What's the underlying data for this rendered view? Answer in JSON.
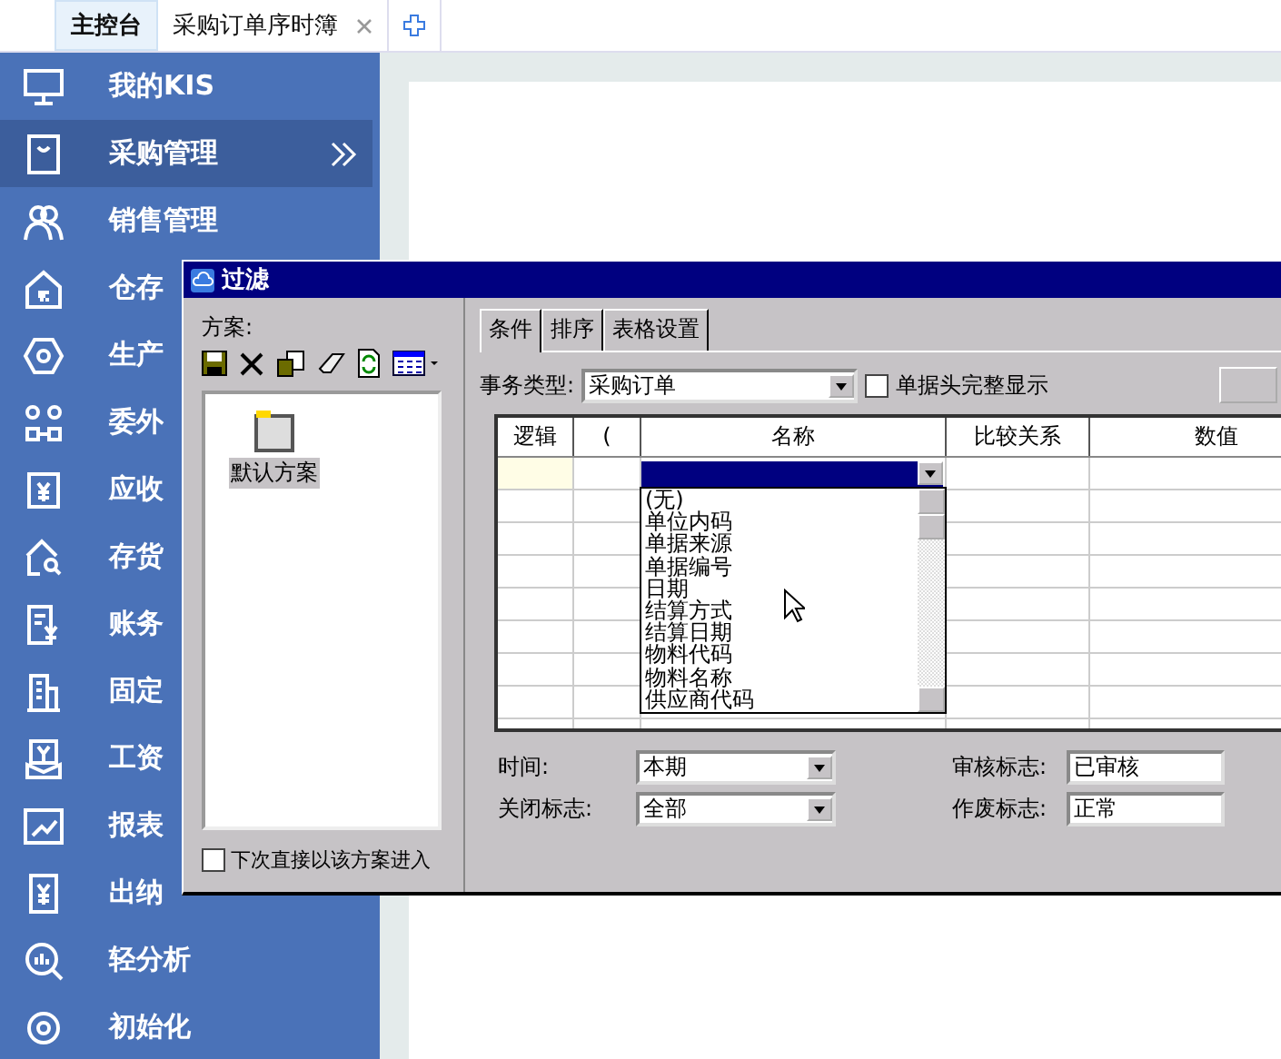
{
  "top_tabs": [
    {
      "label": "主控台",
      "selected": true,
      "closable": false
    },
    {
      "label": "采购订单序时簿",
      "selected": false,
      "closable": true
    }
  ],
  "sidebar": {
    "items": [
      {
        "label": "我的KIS",
        "selected": false,
        "expand": false
      },
      {
        "label": "采购管理",
        "selected": true,
        "expand": true
      },
      {
        "label": "销售管理",
        "selected": false,
        "expand": false
      },
      {
        "label": "仓存",
        "selected": false,
        "expand": false
      },
      {
        "label": "生产",
        "selected": false,
        "expand": false
      },
      {
        "label": "委外",
        "selected": false,
        "expand": false
      },
      {
        "label": "应收",
        "selected": false,
        "expand": false
      },
      {
        "label": "存货",
        "selected": false,
        "expand": false
      },
      {
        "label": "账务",
        "selected": false,
        "expand": false
      },
      {
        "label": "固定",
        "selected": false,
        "expand": false
      },
      {
        "label": "工资",
        "selected": false,
        "expand": false
      },
      {
        "label": "报表",
        "selected": false,
        "expand": false
      },
      {
        "label": "出纳",
        "selected": false,
        "expand": false
      },
      {
        "label": "轻分析",
        "selected": false,
        "expand": false
      },
      {
        "label": "初始化",
        "selected": false,
        "expand": false
      }
    ]
  },
  "dialog": {
    "title": "过滤",
    "scheme_label": "方案:",
    "schemes": [
      {
        "label": "默认方案",
        "selected": true
      }
    ],
    "remember_checkbox": {
      "label": "下次直接以该方案进入",
      "checked": false
    },
    "tabs": [
      {
        "label": "条件",
        "selected": true
      },
      {
        "label": "排序",
        "selected": false
      },
      {
        "label": "表格设置",
        "selected": false
      }
    ],
    "transaction_type": {
      "label": "事务类型:",
      "value": "采购订单"
    },
    "full_header_checkbox": {
      "label": "单据头完整显示",
      "checked": false
    },
    "grid": {
      "columns": [
        "逻辑",
        "(",
        "名称",
        "比较关系",
        "数值"
      ],
      "rows": [
        {
          "selected": true
        },
        {
          "selected": false
        },
        {
          "selected": false
        },
        {
          "selected": false
        },
        {
          "selected": false
        },
        {
          "selected": false
        },
        {
          "selected": false
        },
        {
          "selected": false
        },
        {
          "selected": false
        }
      ],
      "name_dropdown": {
        "options": [
          "(无)",
          "单位内码",
          "单据来源",
          "单据编号",
          "日期",
          "结算方式",
          "结算日期",
          "物料代码",
          "物料名称",
          "供应商代码"
        ]
      }
    },
    "filters": [
      {
        "label": "时间:",
        "value": "本期",
        "kind": "dropdown"
      },
      {
        "label": "审核标志:",
        "value": "已审核",
        "kind": "field"
      },
      {
        "label": "关闭标志:",
        "value": "全部",
        "kind": "dropdown"
      },
      {
        "label": "作废标志:",
        "value": "正常",
        "kind": "field"
      }
    ]
  }
}
